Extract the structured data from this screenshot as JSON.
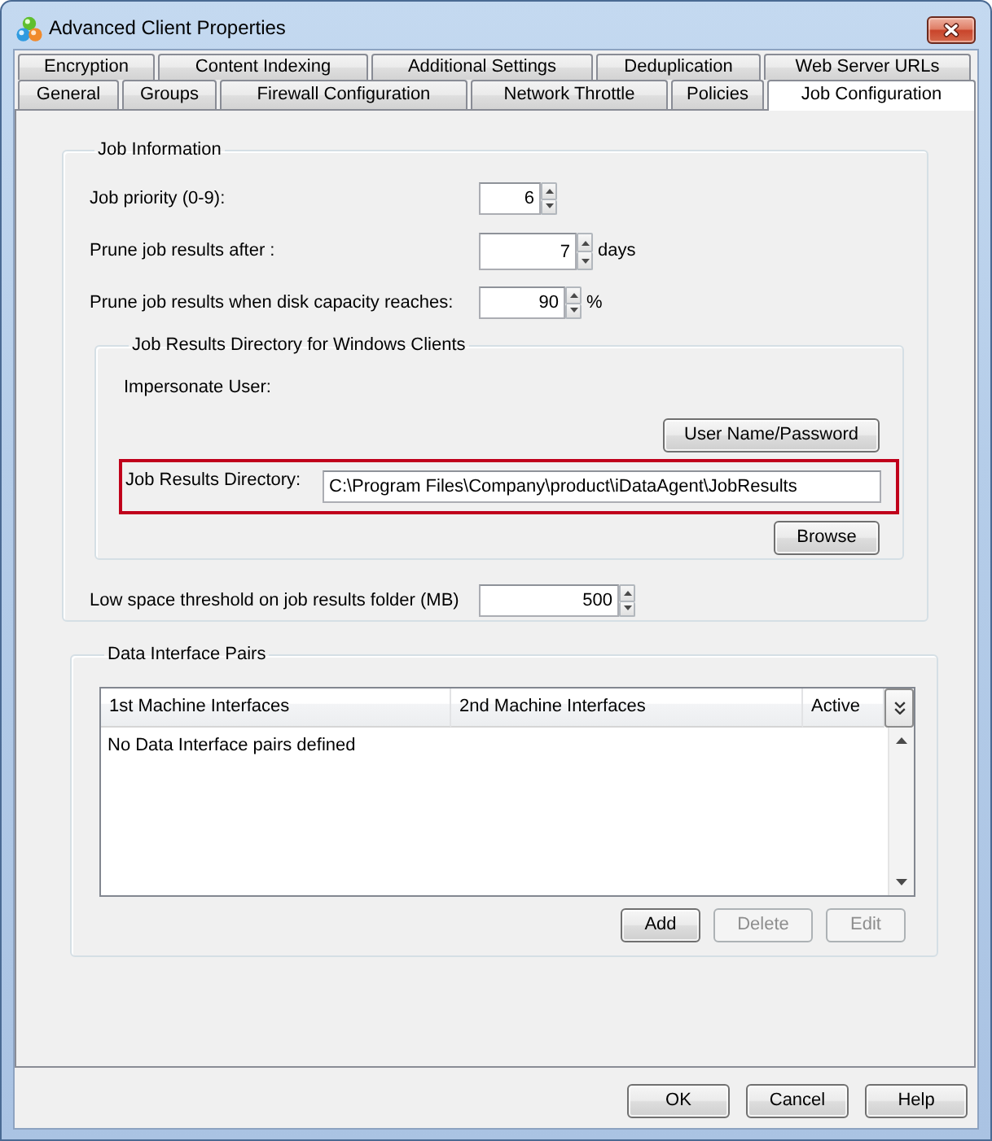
{
  "window": {
    "title": "Advanced Client Properties"
  },
  "tab_rows": [
    {
      "tabs": [
        {
          "label": "Encryption",
          "selected": false
        },
        {
          "label": "Content Indexing",
          "selected": false
        },
        {
          "label": "Additional Settings",
          "selected": false
        },
        {
          "label": "Deduplication",
          "selected": false
        },
        {
          "label": "Web Server URLs",
          "selected": false
        }
      ]
    },
    {
      "tabs": [
        {
          "label": "General",
          "selected": false
        },
        {
          "label": "Groups",
          "selected": false
        },
        {
          "label": "Firewall Configuration",
          "selected": false
        },
        {
          "label": "Network Throttle",
          "selected": false
        },
        {
          "label": "Policies",
          "selected": false
        },
        {
          "label": "Job Configuration",
          "selected": true
        }
      ]
    }
  ],
  "job_information": {
    "title": "Job Information",
    "settings": [
      {
        "label": "Job priority (0-9):",
        "value": "6"
      },
      {
        "label": "Prune job results after :",
        "value": "7",
        "unit": "days"
      },
      {
        "label": "Prune job results when disk capacity reaches:",
        "value": "90",
        "unit": "%"
      }
    ],
    "windows_clients": {
      "title": "Job Results Directory for Windows Clients",
      "impersonate_label": "Impersonate User:",
      "credentials_button": "User Name/Password",
      "directory": {
        "label": "Job Results Directory:",
        "value": "C:\\Program Files\\Company\\product\\iDataAgent\\JobResults",
        "highlighted": true
      },
      "browse_button": "Browse"
    },
    "low_space": {
      "label": "Low space threshold on job results folder (MB)",
      "value": "500"
    }
  },
  "data_interface_pairs": {
    "title": "Data Interface Pairs",
    "columns": [
      "1st Machine Interfaces",
      "2nd Machine Interfaces",
      "Active"
    ],
    "empty_message": "No Data Interface pairs defined",
    "buttons": [
      {
        "label": "Add",
        "disabled": false
      },
      {
        "label": "Delete",
        "disabled": true
      },
      {
        "label": "Edit",
        "disabled": true
      }
    ]
  },
  "dialog_buttons": [
    {
      "label": "OK"
    },
    {
      "label": "Cancel"
    },
    {
      "label": "Help"
    }
  ]
}
